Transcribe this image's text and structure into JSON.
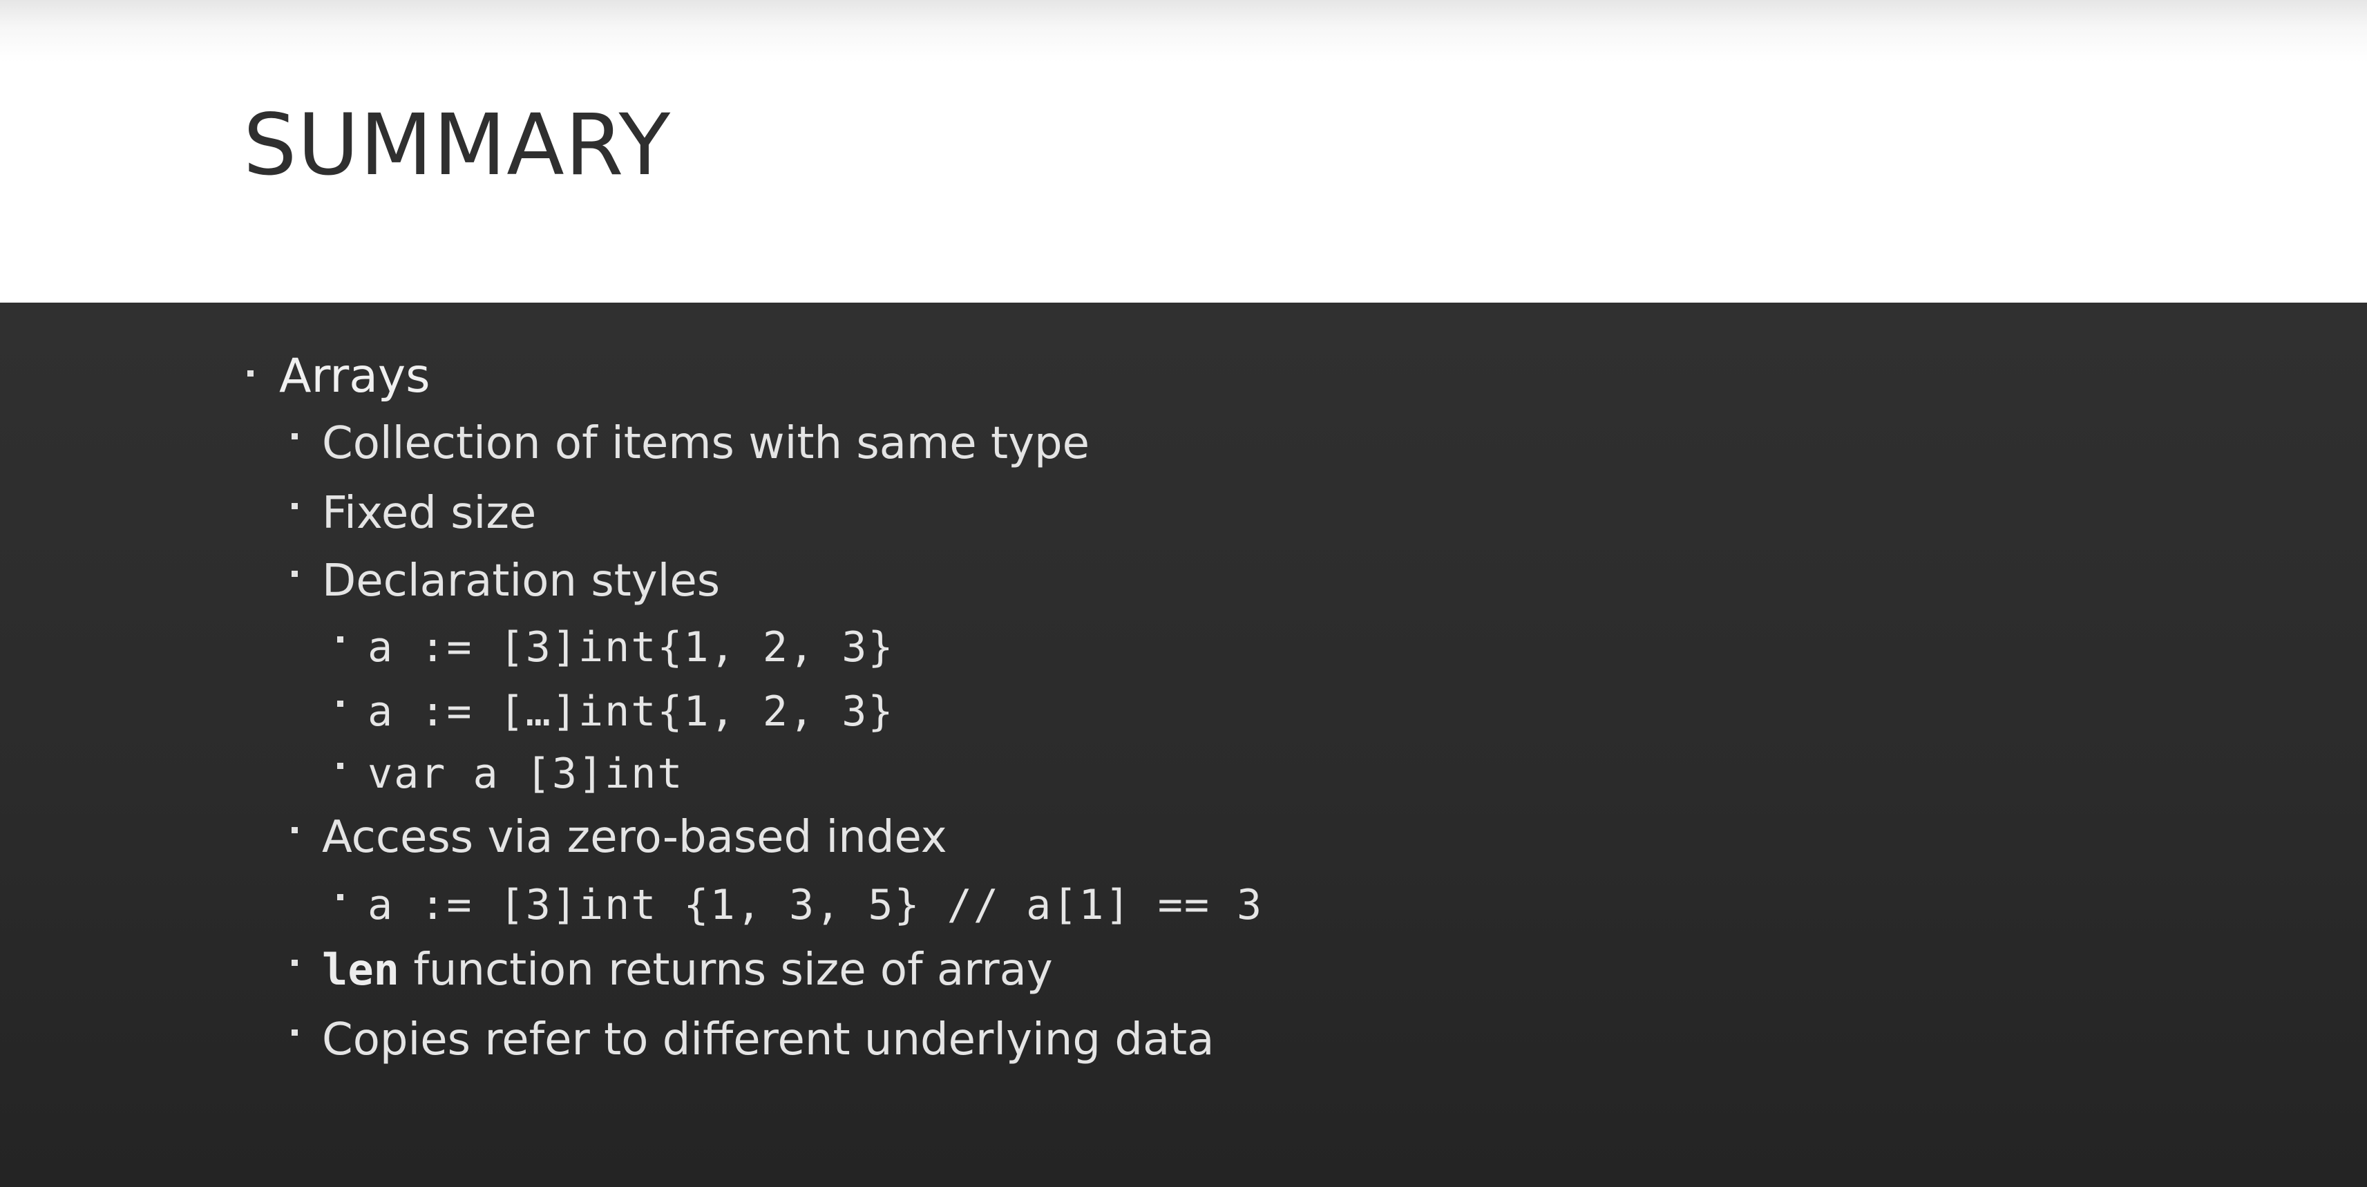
{
  "slide": {
    "title": "SUMMARY",
    "bullets": [
      {
        "level": 1,
        "text": "Arrays"
      },
      {
        "level": 2,
        "text": "Collection of items with same type"
      },
      {
        "level": 2,
        "text": "Fixed size"
      },
      {
        "level": 2,
        "text": "Declaration styles"
      },
      {
        "level": 3,
        "code": "a := [3]int{1, 2, 3}"
      },
      {
        "level": 3,
        "code": "a := […]int{1, 2, 3}"
      },
      {
        "level": 3,
        "code": "var a [3]int"
      },
      {
        "level": 2,
        "text": "Access via zero-based index"
      },
      {
        "level": 3,
        "code": "a := [3]int {1, 3, 5} // a[1] == 3"
      },
      {
        "level": 2,
        "code": "len",
        "text": " function returns size of array"
      },
      {
        "level": 2,
        "text": "Copies refer to different underlying data"
      }
    ]
  },
  "colors": {
    "header_bg": "#ffffff",
    "body_bg": "#2b2b2b",
    "title_text": "#2f2f2f",
    "body_text": "#e4e4e4"
  }
}
